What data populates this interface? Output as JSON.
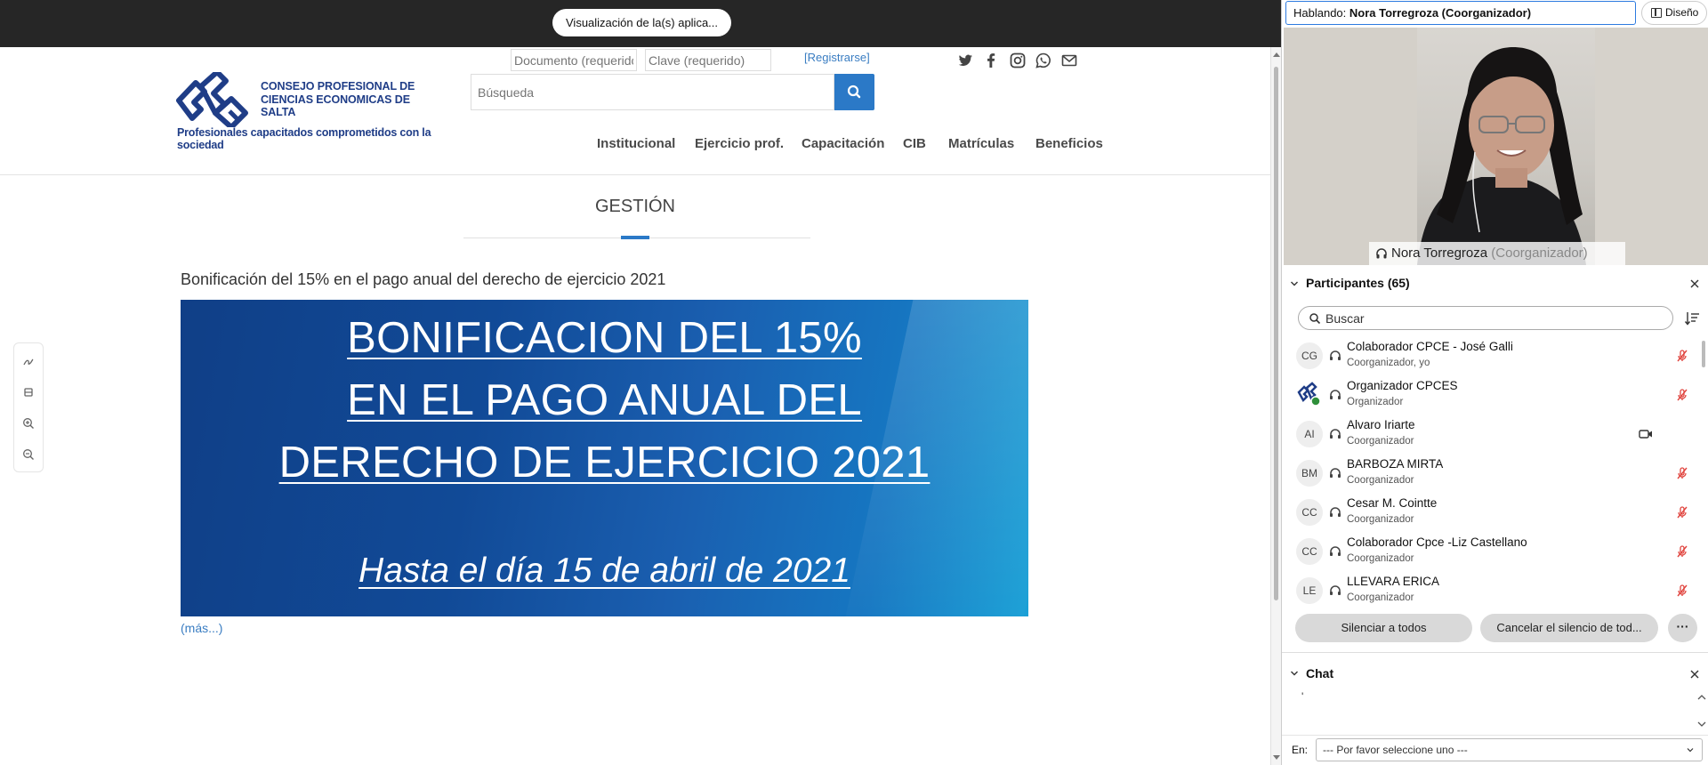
{
  "share": {
    "pill_label": "Visualización de la(s) aplica..."
  },
  "site": {
    "logo": {
      "org_name": "CONSEJO PROFESIONAL DE CIENCIAS ECONOMICAS DE SALTA",
      "tagline": "Profesionales capacitados comprometidos con la sociedad"
    },
    "login": {
      "document_placeholder": "Documento (requerido)",
      "password_placeholder": "Clave (requerido)",
      "register_label": "[Registrarse]"
    },
    "search_placeholder": "Búsqueda",
    "social_icons": [
      "twitter-icon",
      "facebook-icon",
      "instagram-icon",
      "whatsapp-icon",
      "mail-icon"
    ],
    "nav": [
      "Institucional",
      "Ejercicio prof.",
      "Capacitación",
      "CIB",
      "Matrículas",
      "Beneficios"
    ],
    "section_title": "GESTIÓN",
    "article": {
      "title": "Bonificación del 15% en el pago anual del derecho de ejercicio 2021",
      "banner_lines": [
        "BONIFICACION DEL 15%",
        "EN EL PAGO ANUAL DEL",
        "DERECHO DE EJERCICIO 2021"
      ],
      "banner_date": "Hasta el día 15 de abril de 2021",
      "more_label": "(más...)"
    },
    "accent_color": "#2b79c7"
  },
  "panel": {
    "speaking_label": "Hablando:",
    "speaking_name": "Nora Torregroza (Coorganizador)",
    "layout_label": "Diseño",
    "video": {
      "name": "Nora Torregroza",
      "role": "(Coorganizador)"
    },
    "participants": {
      "title": "Participantes (65)",
      "search_placeholder": "Buscar",
      "list": [
        {
          "initials": "CG",
          "name": "Colaborador CPCE - José Galli",
          "role": "Coorganizador, yo",
          "media": "muted"
        },
        {
          "initials": "",
          "name": "Organizador CPCES",
          "role": "Organizador",
          "media": "muted",
          "logo_avatar": true
        },
        {
          "initials": "AI",
          "name": "Alvaro Iriarte",
          "role": "Coorganizador",
          "media": "camera"
        },
        {
          "initials": "BM",
          "name": "BARBOZA MIRTA",
          "role": "Coorganizador",
          "media": "muted"
        },
        {
          "initials": "CC",
          "name": "Cesar M. Cointte",
          "role": "Coorganizador",
          "media": "muted"
        },
        {
          "initials": "CC",
          "name": "Colaborador Cpce -Liz Castellano",
          "role": "Coorganizador",
          "media": "muted"
        },
        {
          "initials": "LE",
          "name": "LLEVARA ERICA",
          "role": "Coorganizador",
          "media": "muted"
        }
      ],
      "mute_all_label": "Silenciar a todos",
      "unmute_all_label": "Cancelar el silencio de tod...",
      "more_label": "···"
    },
    "chat": {
      "title": "Chat",
      "body_text": "'",
      "to_label": "En:",
      "to_select_value": "--- Por favor seleccione uno ---"
    },
    "mute_color": "#e0443e"
  }
}
